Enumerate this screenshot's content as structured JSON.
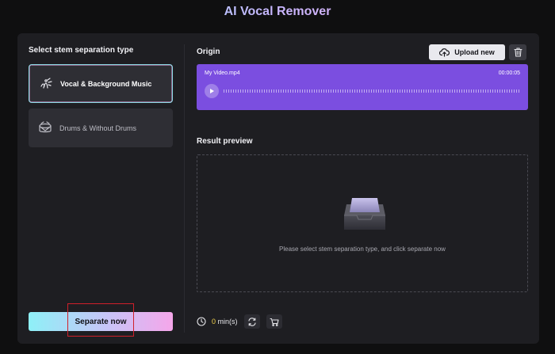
{
  "app": {
    "title": "AI Vocal Remover"
  },
  "left": {
    "title": "Select stem separation type",
    "options": [
      {
        "label": "Vocal & Background Music",
        "icon": "vocal-wave-icon",
        "selected": true
      },
      {
        "label": "Drums & Without Drums",
        "icon": "drum-icon",
        "selected": false
      }
    ],
    "separate_label": "Separate now"
  },
  "origin": {
    "title": "Origin",
    "upload_label": "Upload new",
    "upload_icon": "cloud-upload-icon",
    "delete_icon": "trash-icon",
    "file": {
      "name": "My Video.mp4",
      "duration": "00:00:05"
    }
  },
  "result": {
    "title": "Result preview",
    "hint": "Please select stem separation type, and click separate now",
    "icon": "empty-tray-icon"
  },
  "footer": {
    "credits_value": "0",
    "credits_unit": " min(s)",
    "icons": [
      "clock-icon",
      "refresh-icon",
      "cart-icon"
    ]
  },
  "colors": {
    "accent_purple": "#7b4ee0",
    "gradient_start": "#8ef0f7",
    "gradient_end": "#f5a6ea",
    "highlight_red": "#d0202a",
    "credits_yellow": "#f2d14b"
  }
}
